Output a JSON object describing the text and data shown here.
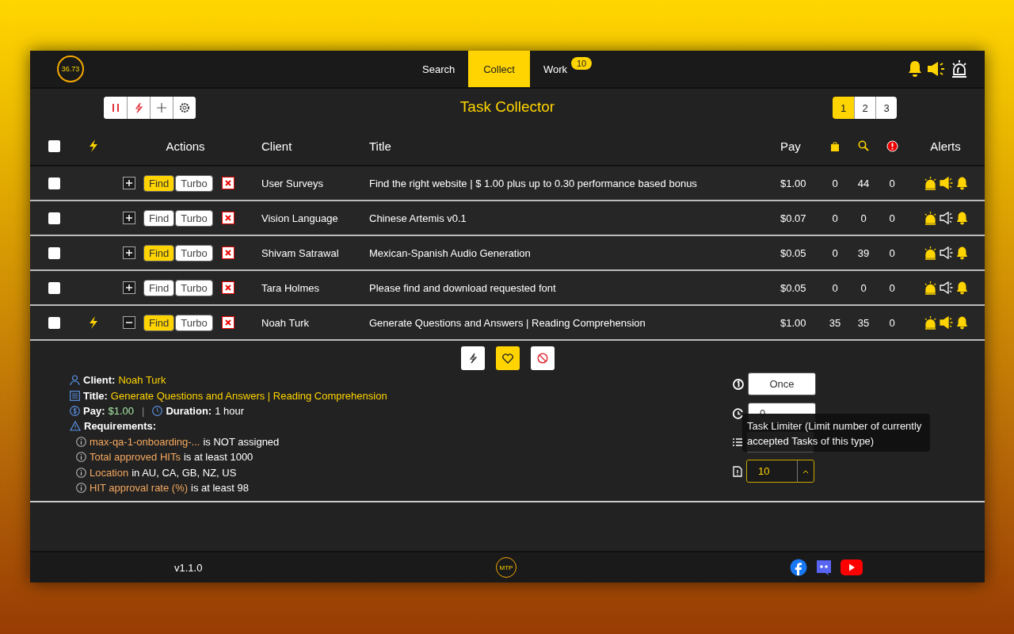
{
  "header": {
    "timer": "36.73",
    "tabs": [
      {
        "label": "Search",
        "selected": false
      },
      {
        "label": "Collect",
        "selected": true
      },
      {
        "label": "Work",
        "selected": false,
        "badge": "10"
      }
    ]
  },
  "toolbar": {
    "title": "Task Collector",
    "pages": [
      {
        "label": "1",
        "selected": true
      },
      {
        "label": "2",
        "selected": false
      },
      {
        "label": "3",
        "selected": false
      }
    ]
  },
  "table": {
    "select_all_checked": false,
    "columns": [
      "Actions",
      "Client",
      "Title",
      "Pay",
      "Alerts"
    ],
    "rows": [
      {
        "checked": false,
        "turbo": false,
        "expanded": false,
        "find_on": true,
        "find": "Find",
        "turbo_label": "Turbo",
        "client": "User Surveys",
        "title": "Find the right website | $ 1.00 plus up to 0.30 performance based bonus",
        "pay": "$1.00",
        "counts": [
          "0",
          "44",
          "0"
        ],
        "siren": true,
        "sound": true,
        "bell": true
      },
      {
        "checked": false,
        "turbo": false,
        "expanded": false,
        "find_on": false,
        "find": "Find",
        "turbo_label": "Turbo",
        "client": "Vision Language",
        "title": "Chinese Artemis v0.1",
        "pay": "$0.07",
        "counts": [
          "0",
          "0",
          "0"
        ],
        "siren": true,
        "sound": false,
        "bell": true
      },
      {
        "checked": false,
        "turbo": false,
        "expanded": false,
        "find_on": true,
        "find": "Find",
        "turbo_label": "Turbo",
        "client": "Shivam Satrawal",
        "title": "Mexican-Spanish Audio Generation",
        "pay": "$0.05",
        "counts": [
          "0",
          "39",
          "0"
        ],
        "siren": true,
        "sound": false,
        "bell": true
      },
      {
        "checked": false,
        "turbo": false,
        "expanded": false,
        "find_on": false,
        "find": "Find",
        "turbo_label": "Turbo",
        "client": "Tara Holmes",
        "title": "Please find and download requested font",
        "pay": "$0.05",
        "counts": [
          "0",
          "0",
          "0"
        ],
        "siren": true,
        "sound": false,
        "bell": true
      },
      {
        "checked": false,
        "turbo": true,
        "expanded": true,
        "find_on": true,
        "find": "Find",
        "turbo_label": "Turbo",
        "client": "Noah Turk",
        "title": "Generate Questions and Answers | Reading Comprehension",
        "pay": "$1.00",
        "counts": [
          "35",
          "35",
          "0"
        ],
        "siren": true,
        "sound": true,
        "bell": true
      }
    ]
  },
  "detail": {
    "favorite": true,
    "client": {
      "label": "Client:",
      "value": "Noah Turk"
    },
    "title": {
      "label": "Title:",
      "value": "Generate Questions and Answers | Reading Comprehension"
    },
    "pay": {
      "label": "Pay:",
      "value": "$1.00"
    },
    "separator": "|",
    "duration": {
      "label": "Duration:",
      "value": "1 hour"
    },
    "requirements_label": "Requirements:",
    "requirements": [
      {
        "name": "max-qa-1-onboarding-...",
        "text": "is NOT assigned"
      },
      {
        "name": "Total approved HITs",
        "text": "is at least 1000"
      },
      {
        "name": "Location",
        "text": "in AU, CA, GB, NZ, US"
      },
      {
        "name": "HIT approval rate (%)",
        "text": "is at least 98"
      }
    ],
    "frequency": "Once",
    "delay": "0",
    "limit": "10",
    "tooltip": "Task Limiter (Limit number of currently accepted Tasks of this type)"
  },
  "footer": {
    "version": "v1.1.0",
    "logo": "MTP"
  }
}
